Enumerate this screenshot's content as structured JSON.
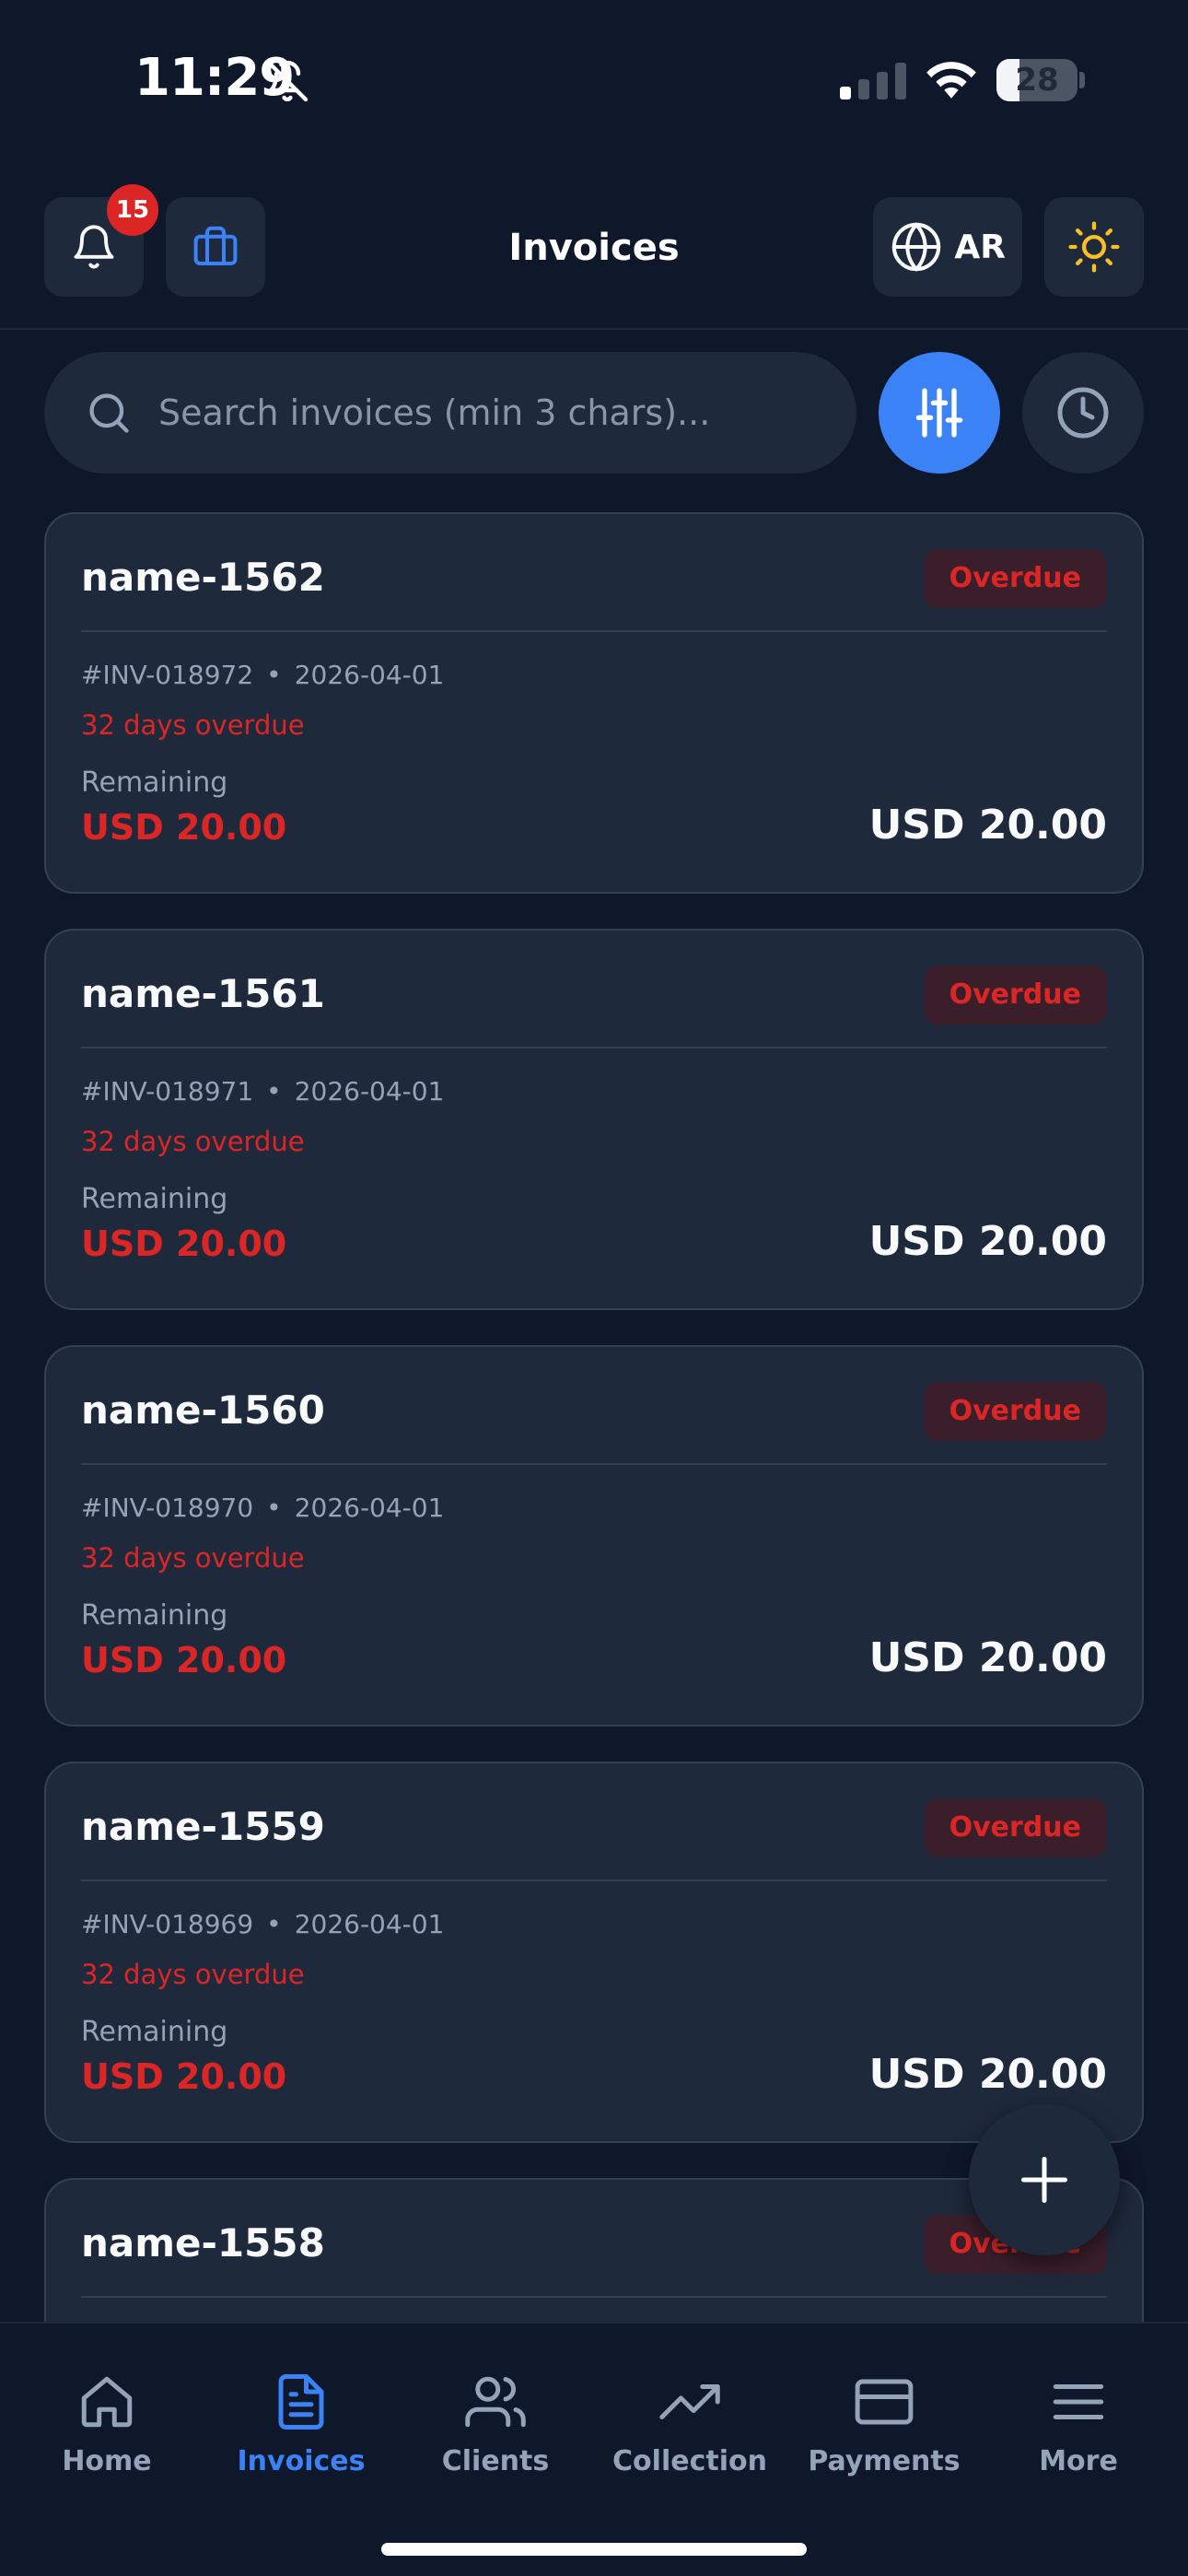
{
  "status_bar": {
    "time": "11:29",
    "battery_level": "28",
    "icons": [
      "bell-slash-icon",
      "cellular-signal-icon",
      "wifi-icon",
      "battery-icon"
    ]
  },
  "header": {
    "title": "Invoices",
    "notification_count": "15",
    "language_label": "AR",
    "icons": [
      "bell-icon",
      "briefcase-icon",
      "globe-icon",
      "sun-icon"
    ]
  },
  "search": {
    "placeholder": "Search invoices (min 3 chars)...",
    "value": ""
  },
  "colors": {
    "accent": "#3b82f6",
    "danger": "#dc2626",
    "background": "#0f172a",
    "surface": "#1e293b"
  },
  "invoices": [
    {
      "name": "name-1562",
      "status": "Overdue",
      "number": "#INV-018972",
      "date": "2026-04-01",
      "overdue_text": "32 days overdue",
      "remaining_label": "Remaining",
      "remaining": "USD 20.00",
      "total": "USD 20.00"
    },
    {
      "name": "name-1561",
      "status": "Overdue",
      "number": "#INV-018971",
      "date": "2026-04-01",
      "overdue_text": "32 days overdue",
      "remaining_label": "Remaining",
      "remaining": "USD 20.00",
      "total": "USD 20.00"
    },
    {
      "name": "name-1560",
      "status": "Overdue",
      "number": "#INV-018970",
      "date": "2026-04-01",
      "overdue_text": "32 days overdue",
      "remaining_label": "Remaining",
      "remaining": "USD 20.00",
      "total": "USD 20.00"
    },
    {
      "name": "name-1559",
      "status": "Overdue",
      "number": "#INV-018969",
      "date": "2026-04-01",
      "overdue_text": "32 days overdue",
      "remaining_label": "Remaining",
      "remaining": "USD 20.00",
      "total": "USD 20.00"
    },
    {
      "name": "name-1558",
      "status": "Overdue"
    }
  ],
  "nav": {
    "items": [
      {
        "label": "Home",
        "icon": "home-icon"
      },
      {
        "label": "Invoices",
        "icon": "document-icon",
        "active": true
      },
      {
        "label": "Clients",
        "icon": "users-icon"
      },
      {
        "label": "Collection",
        "icon": "trending-up-icon"
      },
      {
        "label": "Payments",
        "icon": "credit-card-icon"
      },
      {
        "label": "More",
        "icon": "menu-icon"
      }
    ]
  }
}
